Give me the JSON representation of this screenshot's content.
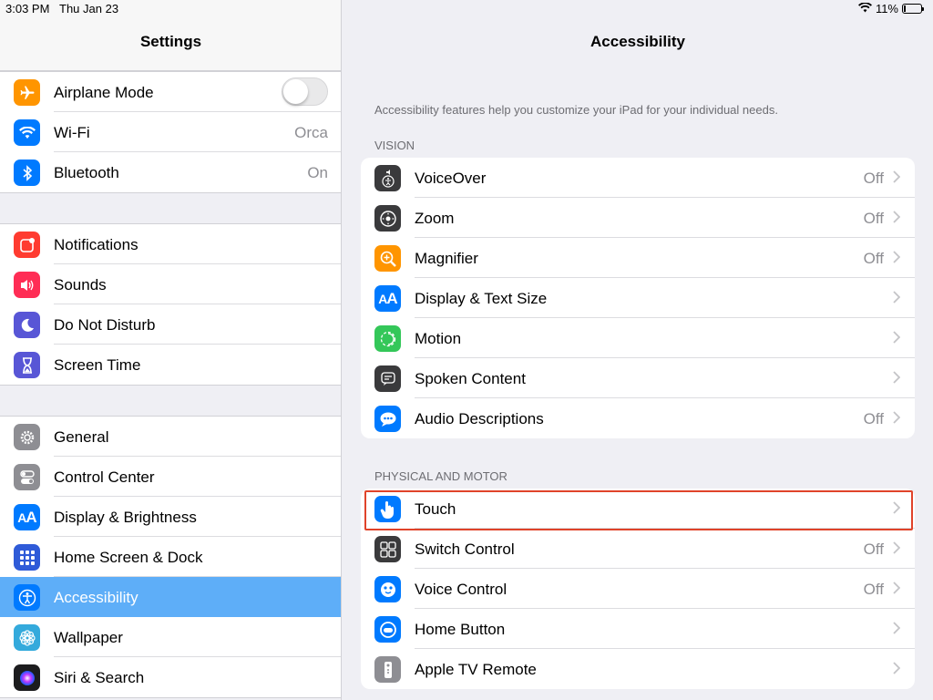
{
  "status": {
    "time": "3:03 PM",
    "date": "Thu Jan 23",
    "battery": "11%",
    "battery_level": 0.11
  },
  "sidebar": {
    "title": "Settings",
    "groups": [
      {
        "items": [
          {
            "label": "Airplane Mode",
            "icon": "airplane-icon",
            "color": "#ff9500",
            "toggle": false
          },
          {
            "label": "Wi-Fi",
            "icon": "wifi-icon",
            "color": "#007aff",
            "value": "Orca"
          },
          {
            "label": "Bluetooth",
            "icon": "bluetooth-icon",
            "color": "#007aff",
            "value": "On"
          }
        ]
      },
      {
        "items": [
          {
            "label": "Notifications",
            "icon": "notifications-icon",
            "color": "#ff3b30"
          },
          {
            "label": "Sounds",
            "icon": "speaker-icon",
            "color": "#ff2d55"
          },
          {
            "label": "Do Not Disturb",
            "icon": "moon-icon",
            "color": "#5856d6"
          },
          {
            "label": "Screen Time",
            "icon": "hourglass-icon",
            "color": "#5856d6"
          }
        ]
      },
      {
        "items": [
          {
            "label": "General",
            "icon": "gear-icon",
            "color": "#8e8e93"
          },
          {
            "label": "Control Center",
            "icon": "switches-icon",
            "color": "#8e8e93"
          },
          {
            "label": "Display & Brightness",
            "icon": "text-size-icon",
            "color": "#007aff"
          },
          {
            "label": "Home Screen & Dock",
            "icon": "grid-icon",
            "color": "#2f5bd8"
          },
          {
            "label": "Accessibility",
            "icon": "accessibility-icon",
            "color": "#007aff",
            "selected": true
          },
          {
            "label": "Wallpaper",
            "icon": "flower-icon",
            "color": "#34aadc"
          },
          {
            "label": "Siri & Search",
            "icon": "siri-icon",
            "color": "#1c1c1e"
          }
        ]
      }
    ]
  },
  "main": {
    "title": "Accessibility",
    "description": "Accessibility features help you customize your iPad for your individual needs.",
    "sections": [
      {
        "header": "VISION",
        "items": [
          {
            "label": "VoiceOver",
            "icon": "voiceover-icon",
            "color": "#3a3a3c",
            "value": "Off"
          },
          {
            "label": "Zoom",
            "icon": "zoom-icon",
            "color": "#3a3a3c",
            "value": "Off"
          },
          {
            "label": "Magnifier",
            "icon": "magnifier-icon",
            "color": "#ff9500",
            "value": "Off"
          },
          {
            "label": "Display & Text Size",
            "icon": "text-size-icon",
            "color": "#007aff",
            "value": ""
          },
          {
            "label": "Motion",
            "icon": "motion-icon",
            "color": "#34c759",
            "value": ""
          },
          {
            "label": "Spoken Content",
            "icon": "spoken-content-icon",
            "color": "#3a3a3c",
            "value": ""
          },
          {
            "label": "Audio Descriptions",
            "icon": "speech-bubble-icon",
            "color": "#007aff",
            "value": "Off"
          }
        ]
      },
      {
        "header": "PHYSICAL AND MOTOR",
        "items": [
          {
            "label": "Touch",
            "icon": "hand-icon",
            "color": "#007aff",
            "value": ""
          },
          {
            "label": "Switch Control",
            "icon": "switch-control-icon",
            "color": "#3a3a3c",
            "value": "Off"
          },
          {
            "label": "Voice Control",
            "icon": "voice-control-icon",
            "color": "#007aff",
            "value": "Off"
          },
          {
            "label": "Home Button",
            "icon": "home-button-icon",
            "color": "#007aff",
            "value": ""
          },
          {
            "label": "Apple TV Remote",
            "icon": "remote-icon",
            "color": "#8e8e93",
            "value": ""
          }
        ]
      }
    ]
  }
}
